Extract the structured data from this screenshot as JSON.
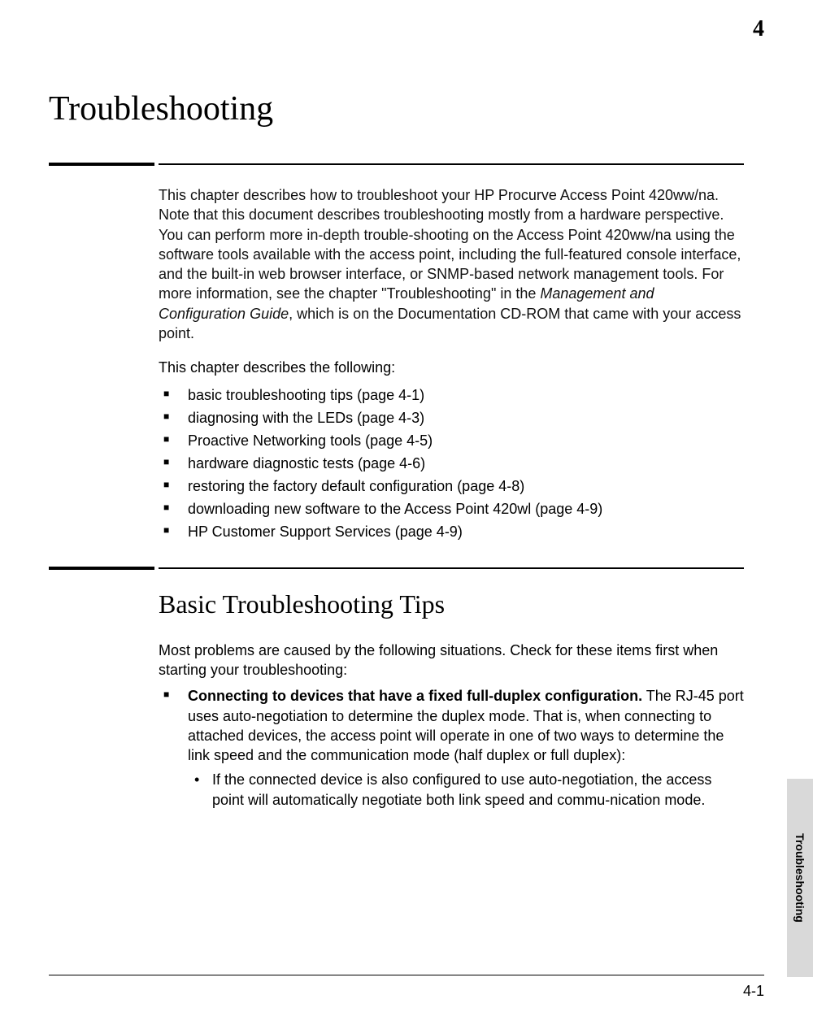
{
  "chapter_number": "4",
  "chapter_title": "Troubleshooting",
  "side_tab": "Troubleshooting",
  "page_number": "4-1",
  "intro": {
    "p1_before_italic": "This chapter describes how to troubleshoot your HP Procurve Access Point 420ww/na. Note that this document describes troubleshooting mostly from a hardware perspective. You can perform more in-depth trouble-shooting on the Access Point 420ww/na using the software tools available with the access point, including the full-featured console interface, and the built-in web browser interface, or SNMP-based network management tools. For more information, see the chapter \"Troubleshooting\" in the ",
    "p1_italic": "Management and Configuration Guide",
    "p1_after_italic": ", which is on the Documentation CD-ROM that came with your access point."
  },
  "list_intro": "This chapter describes the following:",
  "bullets": [
    "basic troubleshooting tips (page 4-1)",
    "diagnosing with the LEDs (page 4-3)",
    "Proactive Networking tools (page 4-5)",
    "hardware diagnostic tests (page 4-6)",
    "restoring the factory default configuration (page 4-8)",
    "downloading new software to the Access Point 420wl (page 4-9)",
    "HP Customer Support Services (page 4-9)"
  ],
  "section_heading": "Basic Troubleshooting Tips",
  "section_intro": "Most problems are caused by the following situations. Check for these items first when starting your troubleshooting:",
  "tip": {
    "bold": "Connecting to devices that have a fixed full-duplex configuration.",
    "rest": " The RJ-45 port uses auto-negotiation to determine the duplex mode. That is, when connecting to attached devices, the access point will operate in one of two ways to determine the link speed and the communication mode (half duplex or full duplex):",
    "sub": "If the connected device is also configured to use auto-negotiation, the access point will automatically negotiate both link speed and commu-nication mode."
  }
}
